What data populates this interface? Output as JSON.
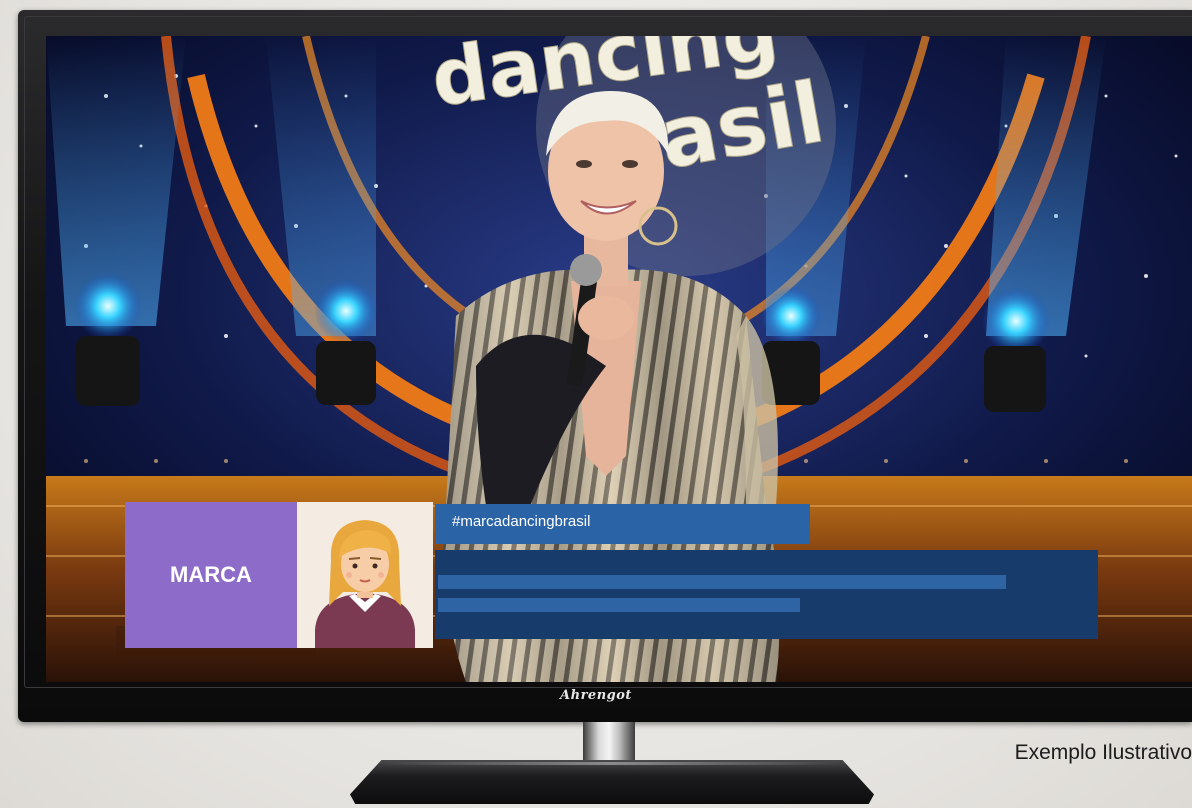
{
  "overlay": {
    "brand_label": "MARCA",
    "hashtag": "#marcadancingbrasil"
  },
  "tv": {
    "logo_text": "Ahrengot",
    "show_logo_line1": "dancing",
    "show_logo_line2": "brasil"
  },
  "caption": "Exemplo Ilustrativo",
  "colors": {
    "brand_box": "#8d6cc9",
    "hashtag_bar": "#2a64a6",
    "panel": "#173b6b",
    "panel_lines": "#2e63a4"
  },
  "icons": {
    "avatar": "woman-avatar-icon"
  }
}
